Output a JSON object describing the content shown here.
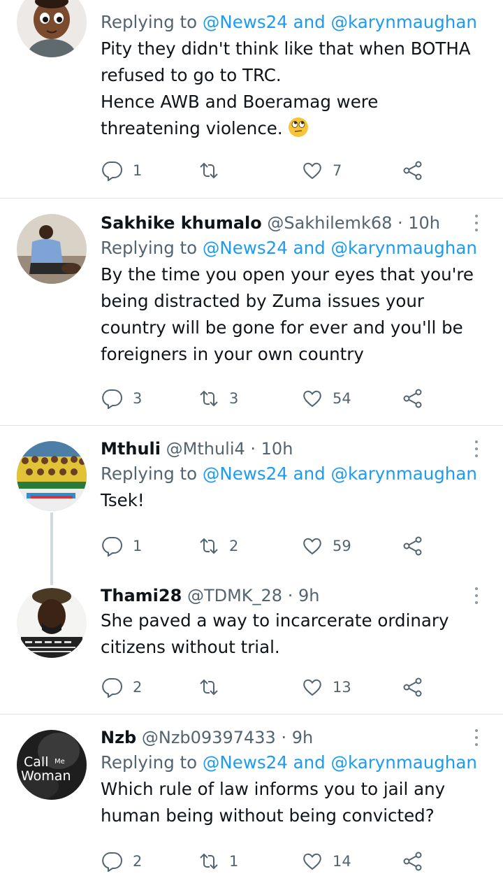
{
  "tweets": [
    {
      "name": "",
      "handle": "",
      "time": "",
      "reply_prefix": "Replying to",
      "reply_mentions": "@News24 and @karynmaughan",
      "text_lines": [
        "Pity they didn't think like that when BOTHA",
        "refused to go to TRC.",
        "Hence AWB and Boeramag were",
        "threatening violence."
      ],
      "emoji": "face-with-rolling-eyes",
      "replies": "1",
      "retweets": "",
      "likes": "7"
    },
    {
      "name": "Sakhike khumalo",
      "handle": "@Sakhilemk68 · 10h",
      "reply_prefix": "Replying to",
      "reply_mentions": "@News24 and @karynmaughan",
      "text_lines": [
        "By the time you open your eyes that you're",
        "being distracted by Zuma issues your",
        "country will be gone for ever and you'll be",
        "foreigners in your own country"
      ],
      "replies": "3",
      "retweets": "3",
      "likes": "54"
    },
    {
      "name": "Mthuli",
      "handle": "@Mthuli4 · 10h",
      "reply_prefix": "Replying to",
      "reply_mentions": "@News24 and @karynmaughan",
      "text_lines": [
        "Tsek!"
      ],
      "replies": "1",
      "retweets": "2",
      "likes": "59"
    },
    {
      "name": "Thami28",
      "handle": "@TDMK_28 · 9h",
      "text_lines": [
        "She paved a way to incarcerate ordinary",
        "citizens without trial."
      ],
      "replies": "2",
      "retweets": "",
      "likes": "13"
    },
    {
      "name": "Nzb",
      "handle": "@Nzb09397433 · 9h",
      "reply_prefix": "Replying to",
      "reply_mentions": "@News24 and @karynmaughan",
      "text_lines": [
        "Which rule of law informs you to jail any",
        "human being without being convicted?"
      ],
      "replies": "2",
      "retweets": "1",
      "likes": "14",
      "avatar_text": [
        "Call",
        "Me",
        "Woman"
      ]
    }
  ],
  "icons": {
    "reply": "reply-icon",
    "retweet": "retweet-icon",
    "like": "heart-icon",
    "share": "share-icon",
    "more": "more-vertical-icon"
  },
  "colors": {
    "link": "#1d9bf0",
    "secondary": "#536471",
    "text": "#0f1419",
    "divider": "#dfe3e6"
  }
}
